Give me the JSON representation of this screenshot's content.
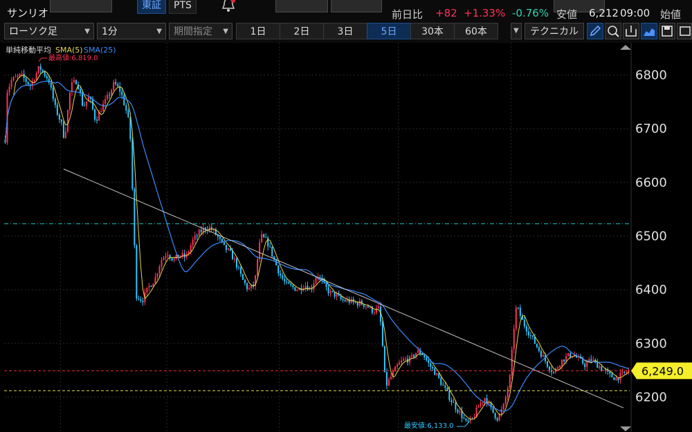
{
  "stock": {
    "name": "サンリオ"
  },
  "exchange": {
    "primary": "東証",
    "secondary": "PTS"
  },
  "quote": {
    "change_label": "前日比",
    "change": "+82",
    "change_pct": "+1.33%",
    "other_pct": "-0.76%",
    "low_label": "安値",
    "low_value": "6,212",
    "time": "09:00",
    "open_label": "始値"
  },
  "toolbar": {
    "chart_type": "ローソク足",
    "interval": "1分",
    "period_placeholder": "期間指定",
    "ranges": [
      "1日",
      "2日",
      "3日",
      "5日",
      "30本",
      "60本"
    ],
    "active_range": "5日",
    "technical_label": "テクニカル"
  },
  "indicator": {
    "title": "単純移動平均",
    "sma_short": "SMA(5)",
    "sma_long": "SMA(25)"
  },
  "annotations": {
    "high": "最高値:6,819.0",
    "low": "最安値:6,133.0",
    "current_price": "6,249.0"
  },
  "colors": {
    "up": "#ff3355",
    "down": "#33c6ff",
    "sma_short": "#e8d84a",
    "sma_long": "#3b8cff",
    "price_tag_bg": "#f5ee2a",
    "red_line": "#e0263a",
    "yellow_line": "#e8e04a",
    "cyan_line": "#1fc7c7",
    "trendline": "#c8c8c8"
  },
  "chart_data": {
    "type": "candlestick",
    "y_ticks": [
      6200,
      6300,
      6400,
      6500,
      6600,
      6700,
      6800
    ],
    "ylim": [
      6135,
      6860
    ],
    "high": 6819,
    "low": 6133,
    "current_price": 6249,
    "cyan_level": 6523,
    "yellow_level": 6212,
    "trendline": {
      "start": 6625,
      "end": 6180
    },
    "path_points": [
      [
        0,
        6680
      ],
      [
        0.003,
        6770
      ],
      [
        0.01,
        6790
      ],
      [
        0.025,
        6800
      ],
      [
        0.04,
        6780
      ],
      [
        0.055,
        6815
      ],
      [
        0.07,
        6790
      ],
      [
        0.08,
        6740
      ],
      [
        0.09,
        6710
      ],
      [
        0.095,
        6680
      ],
      [
        0.105,
        6780
      ],
      [
        0.115,
        6790
      ],
      [
        0.125,
        6740
      ],
      [
        0.135,
        6760
      ],
      [
        0.145,
        6715
      ],
      [
        0.155,
        6740
      ],
      [
        0.165,
        6760
      ],
      [
        0.175,
        6785
      ],
      [
        0.185,
        6770
      ],
      [
        0.195,
        6730
      ],
      [
        0.2,
        6700
      ],
      [
        0.205,
        6560
      ],
      [
        0.21,
        6390
      ],
      [
        0.22,
        6380
      ],
      [
        0.23,
        6405
      ],
      [
        0.24,
        6420
      ],
      [
        0.25,
        6455
      ],
      [
        0.26,
        6470
      ],
      [
        0.27,
        6455
      ],
      [
        0.28,
        6465
      ],
      [
        0.29,
        6460
      ],
      [
        0.3,
        6490
      ],
      [
        0.31,
        6505
      ],
      [
        0.32,
        6515
      ],
      [
        0.33,
        6515
      ],
      [
        0.34,
        6500
      ],
      [
        0.35,
        6480
      ],
      [
        0.36,
        6470
      ],
      [
        0.37,
        6450
      ],
      [
        0.38,
        6420
      ],
      [
        0.39,
        6400
      ],
      [
        0.4,
        6410
      ],
      [
        0.405,
        6460
      ],
      [
        0.41,
        6500
      ],
      [
        0.42,
        6490
      ],
      [
        0.43,
        6460
      ],
      [
        0.44,
        6430
      ],
      [
        0.45,
        6410
      ],
      [
        0.46,
        6405
      ],
      [
        0.47,
        6400
      ],
      [
        0.48,
        6410
      ],
      [
        0.49,
        6400
      ],
      [
        0.5,
        6430
      ],
      [
        0.51,
        6410
      ],
      [
        0.52,
        6395
      ],
      [
        0.53,
        6390
      ],
      [
        0.54,
        6380
      ],
      [
        0.55,
        6380
      ],
      [
        0.56,
        6375
      ],
      [
        0.57,
        6375
      ],
      [
        0.58,
        6370
      ],
      [
        0.59,
        6360
      ],
      [
        0.6,
        6365
      ],
      [
        0.605,
        6300
      ],
      [
        0.61,
        6220
      ],
      [
        0.62,
        6240
      ],
      [
        0.63,
        6260
      ],
      [
        0.64,
        6270
      ],
      [
        0.65,
        6270
      ],
      [
        0.66,
        6285
      ],
      [
        0.67,
        6280
      ],
      [
        0.68,
        6260
      ],
      [
        0.69,
        6245
      ],
      [
        0.7,
        6225
      ],
      [
        0.71,
        6205
      ],
      [
        0.72,
        6185
      ],
      [
        0.73,
        6170
      ],
      [
        0.74,
        6150
      ],
      [
        0.75,
        6160
      ],
      [
        0.76,
        6185
      ],
      [
        0.77,
        6200
      ],
      [
        0.78,
        6175
      ],
      [
        0.79,
        6160
      ],
      [
        0.8,
        6185
      ],
      [
        0.81,
        6240
      ],
      [
        0.815,
        6320
      ],
      [
        0.82,
        6370
      ],
      [
        0.83,
        6340
      ],
      [
        0.84,
        6320
      ],
      [
        0.85,
        6300
      ],
      [
        0.86,
        6280
      ],
      [
        0.87,
        6260
      ],
      [
        0.88,
        6245
      ],
      [
        0.89,
        6265
      ],
      [
        0.9,
        6275
      ],
      [
        0.91,
        6280
      ],
      [
        0.92,
        6270
      ],
      [
        0.93,
        6260
      ],
      [
        0.94,
        6270
      ],
      [
        0.95,
        6260
      ],
      [
        0.96,
        6250
      ],
      [
        0.97,
        6240
      ],
      [
        0.98,
        6235
      ],
      [
        1.0,
        6249
      ]
    ]
  }
}
